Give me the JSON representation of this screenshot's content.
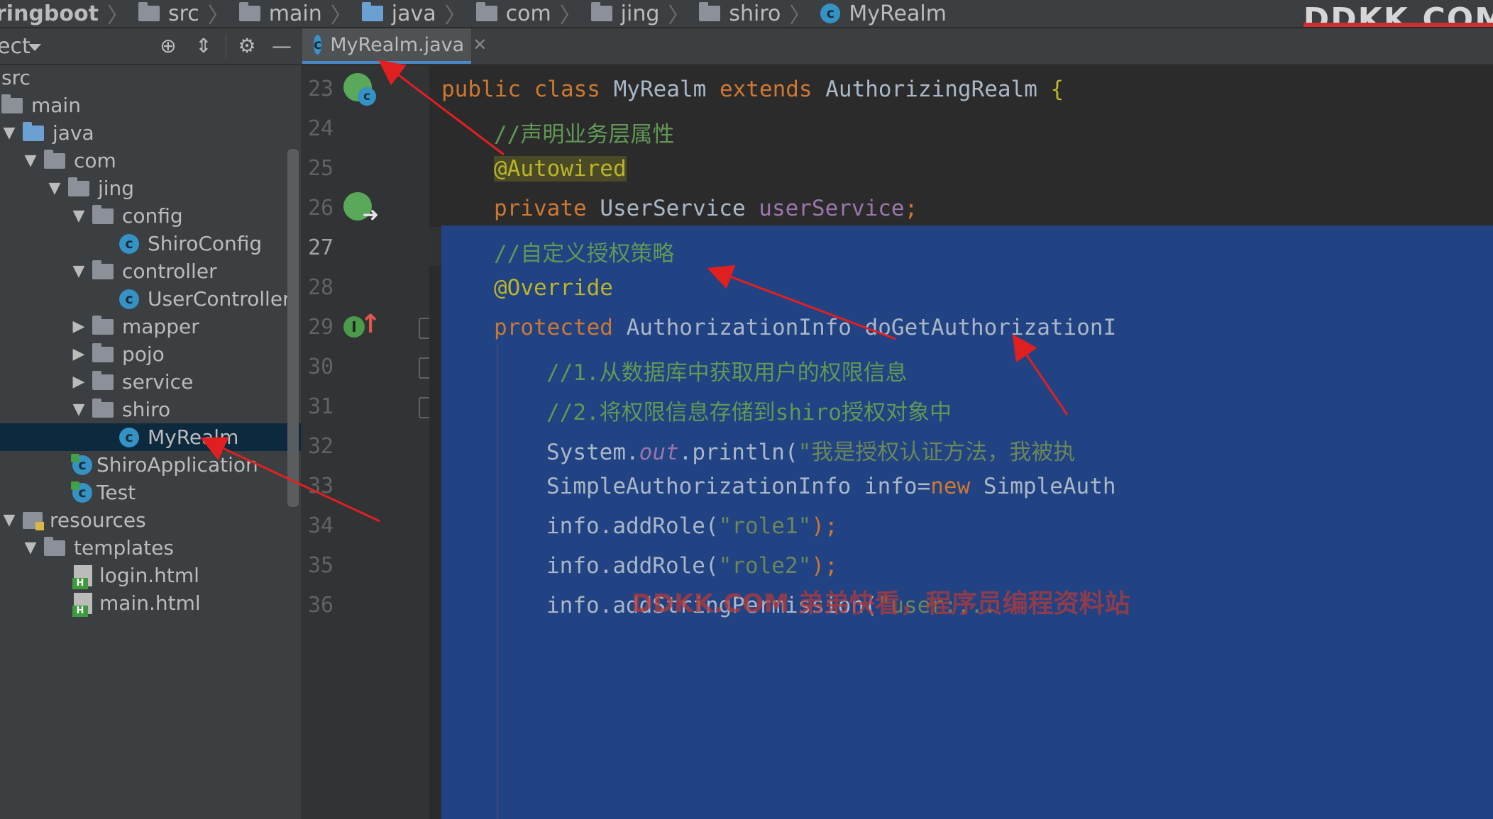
{
  "breadcrumb": {
    "items": [
      "ringboot",
      "src",
      "main",
      "java",
      "com",
      "jing",
      "shiro",
      "MyRealm"
    ],
    "watermark": "DDKK.COM"
  },
  "project_panel": {
    "title": "ect",
    "tree": [
      {
        "label": "src",
        "icon": "none",
        "depth": 0
      },
      {
        "label": "main",
        "icon": "folder",
        "depth": 1
      },
      {
        "label": "java",
        "icon": "folder-blue",
        "depth": 1
      },
      {
        "label": "com",
        "icon": "folder",
        "depth": 2
      },
      {
        "label": "jing",
        "icon": "folder",
        "depth": 3
      },
      {
        "label": "config",
        "icon": "folder",
        "depth": 4
      },
      {
        "label": "ShiroConfig",
        "icon": "class",
        "depth": 5
      },
      {
        "label": "controller",
        "icon": "folder",
        "depth": 4
      },
      {
        "label": "UserController",
        "icon": "class",
        "depth": 5
      },
      {
        "label": "mapper",
        "icon": "folder",
        "depth": 4
      },
      {
        "label": "pojo",
        "icon": "folder",
        "depth": 4
      },
      {
        "label": "service",
        "icon": "folder",
        "depth": 4
      },
      {
        "label": "shiro",
        "icon": "folder",
        "depth": 4
      },
      {
        "label": "MyRealm",
        "icon": "class",
        "depth": 5
      },
      {
        "label": "ShiroApplication",
        "icon": "app",
        "depth": 3
      },
      {
        "label": "Test",
        "icon": "app",
        "depth": 3
      },
      {
        "label": "resources",
        "icon": "resources",
        "depth": 1
      },
      {
        "label": "templates",
        "icon": "folder",
        "depth": 2
      },
      {
        "label": "login.html",
        "icon": "html",
        "depth": 3
      },
      {
        "label": "main.html",
        "icon": "html",
        "depth": 3
      }
    ]
  },
  "editor": {
    "tab_label": "MyRealm.java",
    "line_numbers": [
      "23",
      "24",
      "25",
      "26",
      "27",
      "28",
      "29",
      "30",
      "31",
      "32",
      "33",
      "34",
      "35",
      "36"
    ],
    "lines": {
      "l23_kw1": "public class ",
      "l23_name": "MyRealm ",
      "l23_kw2": "extends ",
      "l23_parent": "AuthorizingRealm ",
      "l23_brace": "{",
      "l24_comment": "//声明业务层属性",
      "l25_annotation": "@Autowired",
      "l26_kw": "private ",
      "l26_type": "UserService ",
      "l26_field": "userService",
      "l26_semi": ";",
      "l27_comment": "//自定义授权策略",
      "l28_annotation": "@Override",
      "l29_kw": "protected ",
      "l29_type": "AuthorizationInfo ",
      "l29_method": "doGetAuthorizationI",
      "l30_comment": "//1.从数据库中获取用户的权限信息",
      "l31_comment": "//2.将权限信息存储到shiro授权对象中",
      "l32_a": "System.",
      "l32_out": "out",
      "l32_b": ".println(",
      "l32_str": "\"我是授权认证方法，我被执",
      "l33_a": "SimpleAuthorizationInfo info=",
      "l33_kw": "new ",
      "l33_b": "SimpleAuth",
      "l34_a": "info.addRole(",
      "l34_str": "\"role1\"",
      "l34_b": ");",
      "l35_a": "info.addRole(",
      "l35_str": "\"role2\"",
      "l35_b": ");",
      "l36_a": "info.addStringPermission(",
      "l36_str": "\"user:..."
    },
    "watermark": "DDKK.COM 弟弟快看，程序员编程资料站"
  },
  "colors": {
    "keyword": "#cc7832",
    "comment": "#629755",
    "annotation": "#bbb529",
    "field": "#9876aa",
    "selection": "#214283",
    "annotation_arrows": "#e02020"
  }
}
